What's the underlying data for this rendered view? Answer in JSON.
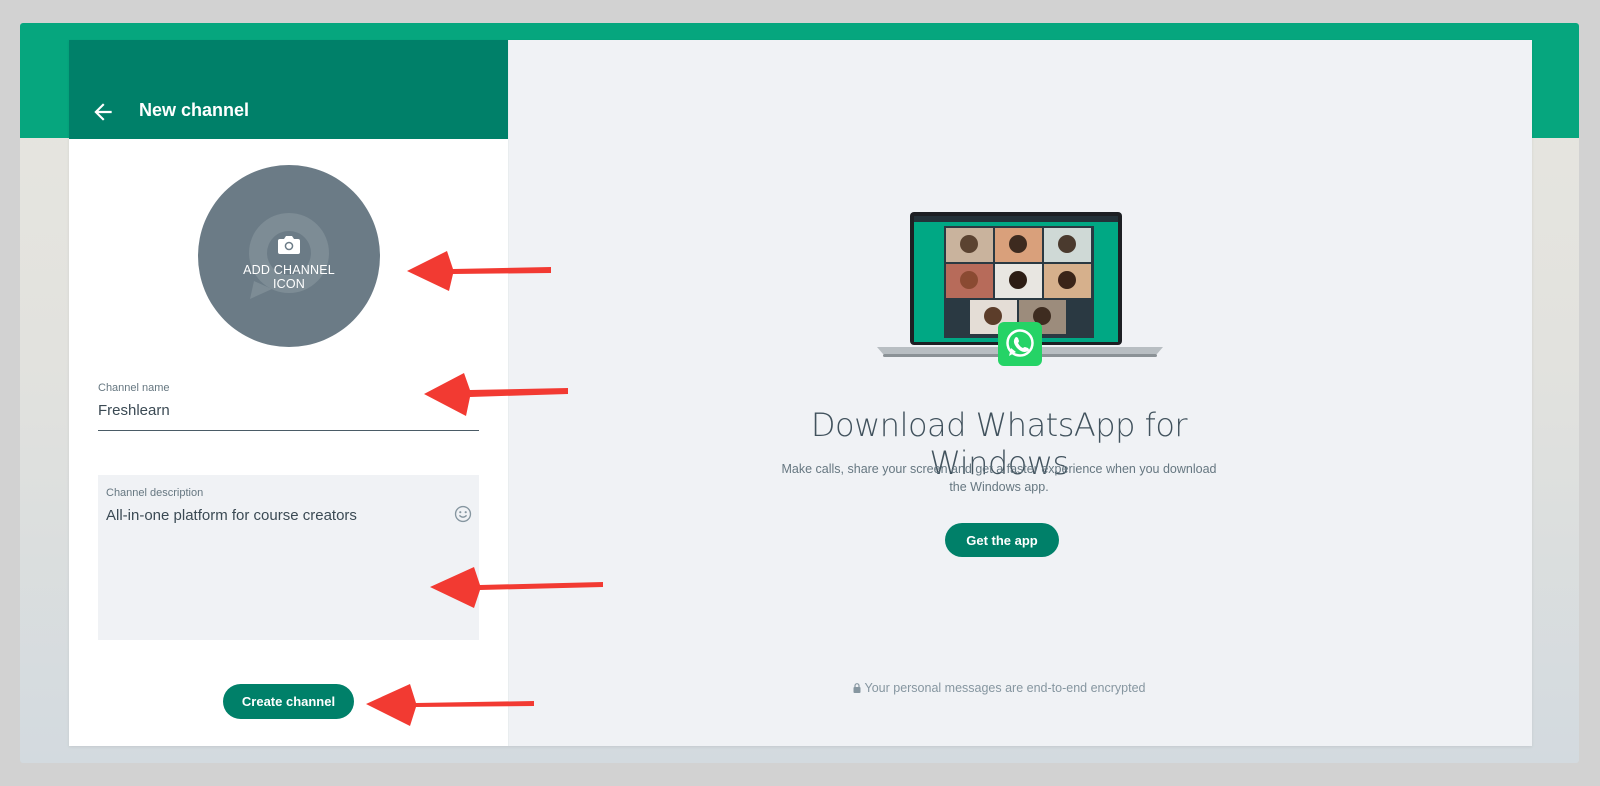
{
  "header": {
    "title": "New channel"
  },
  "avatar": {
    "label": "ADD CHANNEL ICON"
  },
  "channel_name": {
    "label": "Channel name",
    "value": "Freshlearn"
  },
  "channel_description": {
    "label": "Channel description",
    "value": "All-in-one platform for course creators"
  },
  "actions": {
    "create_label": "Create channel"
  },
  "promo": {
    "headline": "Download WhatsApp for Windows",
    "description": "Make calls, share your screen and get a faster experience when you download the Windows app.",
    "button_label": "Get the app"
  },
  "footer": {
    "encryption_note": "Your personal messages are end-to-end encrypted"
  },
  "colors": {
    "brand": "#008069",
    "band": "#06a67e",
    "annotation_arrow": "#f23a32"
  },
  "icons": [
    "back-arrow-icon",
    "camera-icon",
    "emoji-icon",
    "lock-icon",
    "whatsapp-logo-icon",
    "laptop-illustration"
  ]
}
